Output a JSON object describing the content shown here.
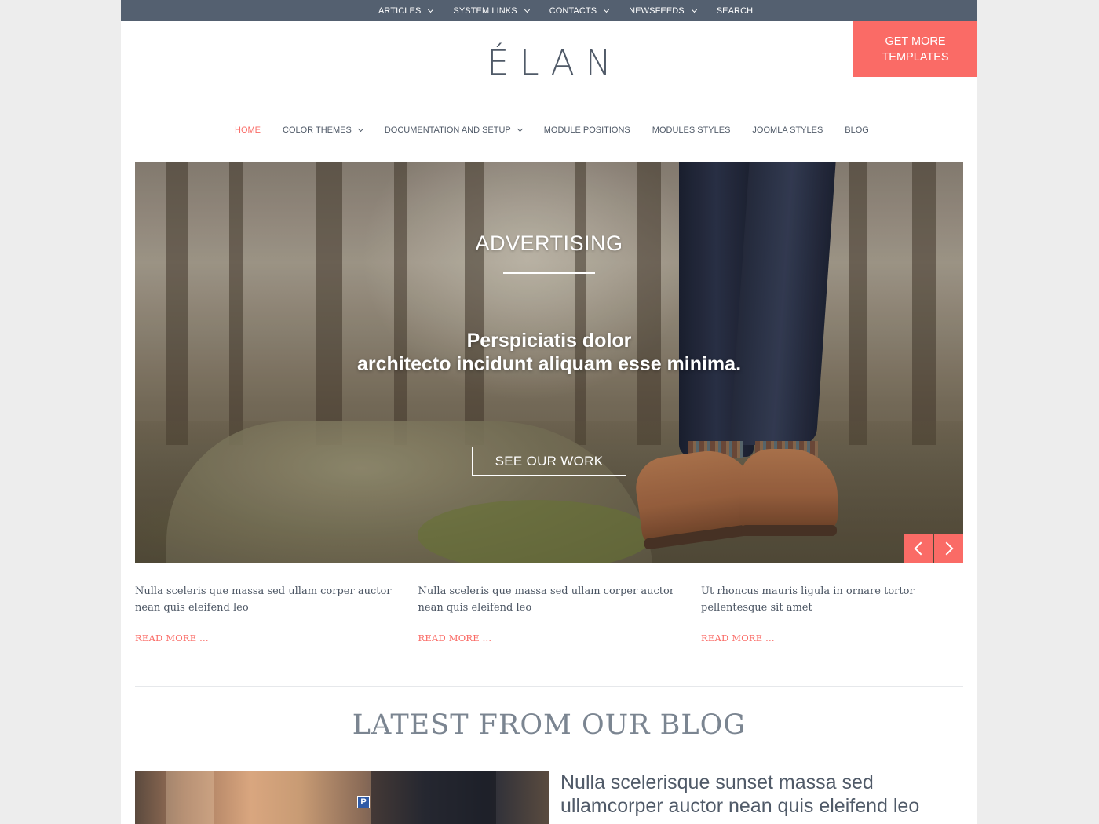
{
  "topnav": {
    "items": [
      {
        "label": "ARTICLES",
        "has_dropdown": true
      },
      {
        "label": "SYSTEM LINKS",
        "has_dropdown": true
      },
      {
        "label": "CONTACTS",
        "has_dropdown": true
      },
      {
        "label": "NEWSFEEDS",
        "has_dropdown": true
      },
      {
        "label": "SEARCH",
        "has_dropdown": false
      }
    ]
  },
  "cta": {
    "label": "GET MORE TEMPLATES"
  },
  "logo": {
    "text": "ÉLAN"
  },
  "mainnav": {
    "items": [
      {
        "label": "HOME",
        "active": true,
        "has_dropdown": false
      },
      {
        "label": "COLOR THEMES",
        "active": false,
        "has_dropdown": true
      },
      {
        "label": "DOCUMENTATION AND SETUP",
        "active": false,
        "has_dropdown": true
      },
      {
        "label": "MODULE POSITIONS",
        "active": false,
        "has_dropdown": false
      },
      {
        "label": "MODULES STYLES",
        "active": false,
        "has_dropdown": false
      },
      {
        "label": "JOOMLA STYLES",
        "active": false,
        "has_dropdown": false
      },
      {
        "label": "BLOG",
        "active": false,
        "has_dropdown": false
      }
    ]
  },
  "hero": {
    "title": "ADVERTISING",
    "subtitle_line1": "Perspiciatis dolor",
    "subtitle_line2": "architecto incidunt aliquam esse minima.",
    "button_label": "SEE OUR WORK",
    "prev_icon": "chevron-left-icon",
    "next_icon": "chevron-right-icon"
  },
  "teasers": [
    {
      "text": "Nulla sceleris que massa sed ullam corper auctor nean quis eleifend leo",
      "link": "READ MORE ..."
    },
    {
      "text": "Nulla sceleris que massa sed ullam corper auctor nean quis eleifend leo",
      "link": "READ MORE ..."
    },
    {
      "text": "Ut rhoncus mauris ligula in ornare tortor pellentesque sit amet",
      "link": "READ MORE ..."
    }
  ],
  "blog": {
    "heading": "LATEST FROM OUR BLOG",
    "post_title": "Nulla scelerisque sunset massa sed ullamcorper auctor nean quis eleifend leo",
    "parking_sign": "P"
  },
  "colors": {
    "accent": "#fa6b66",
    "topbar": "#546070",
    "text": "#505a68",
    "page_bg": "#ededed"
  }
}
